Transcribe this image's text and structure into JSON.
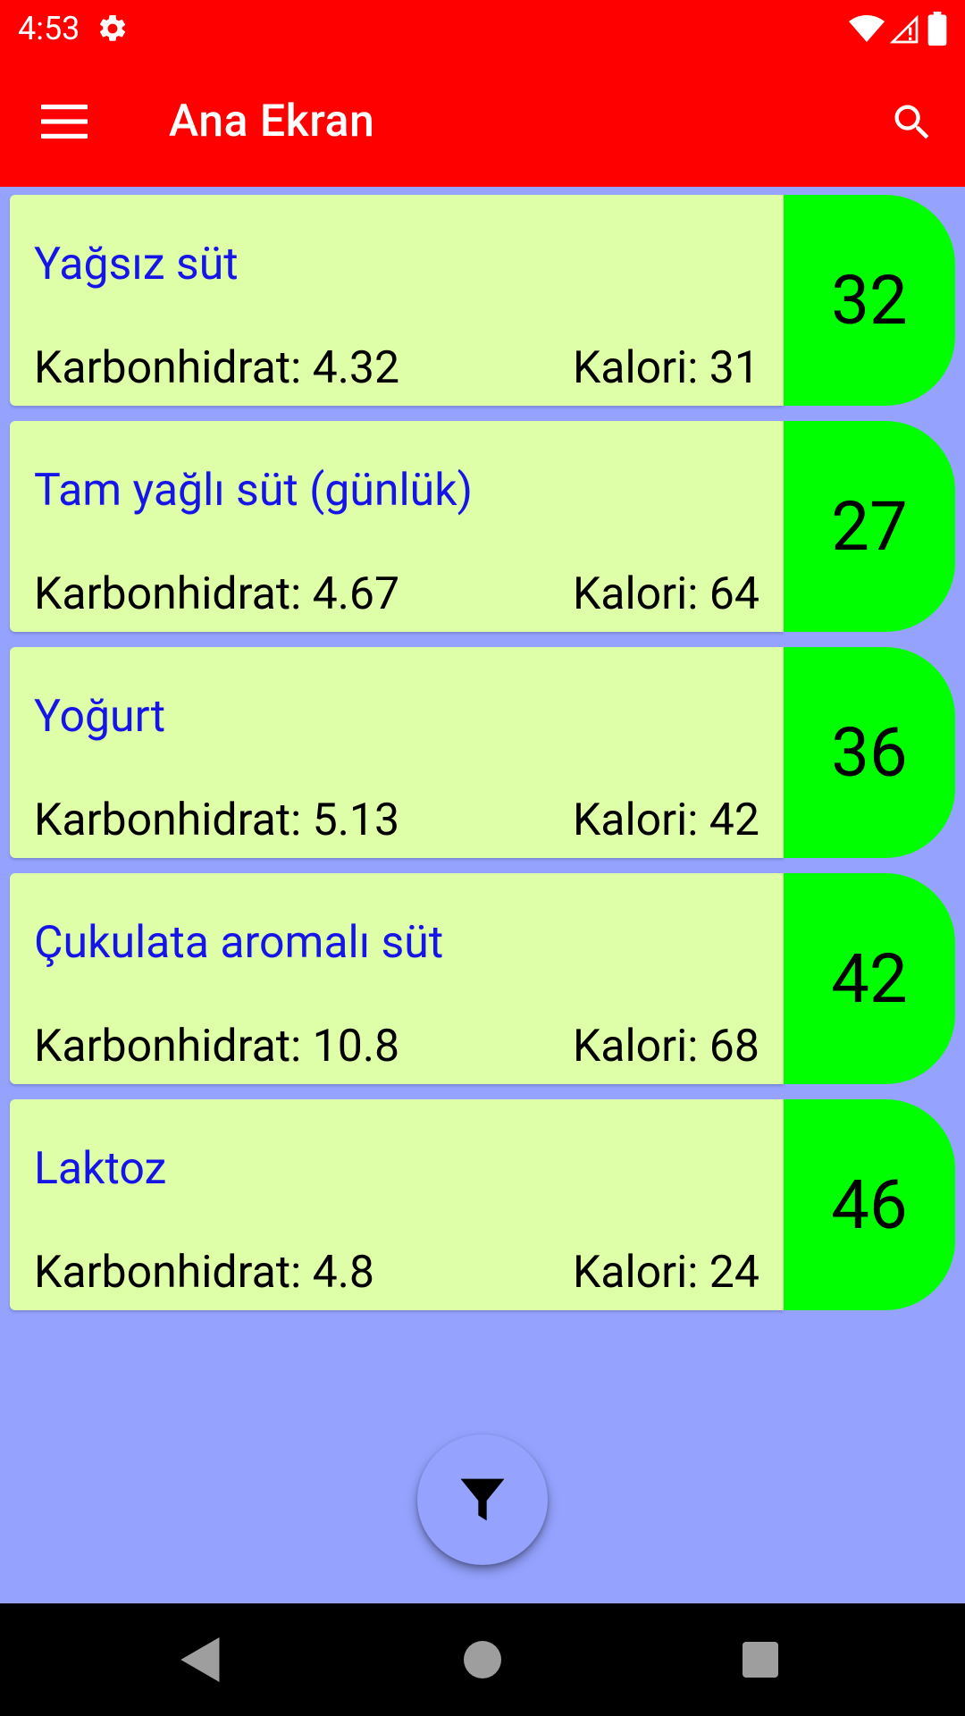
{
  "status_bar": {
    "time": "4:53"
  },
  "app_bar": {
    "title": "Ana Ekran"
  },
  "foods": [
    {
      "name": "Yağsız süt",
      "carb": "Karbonhidrat: 4.32",
      "calorie": "Kalori: 31",
      "gi": "32"
    },
    {
      "name": "Tam yağlı süt (günlük)",
      "carb": "Karbonhidrat: 4.67",
      "calorie": "Kalori: 64",
      "gi": "27"
    },
    {
      "name": "Yoğurt",
      "carb": "Karbonhidrat: 5.13",
      "calorie": "Kalori: 42",
      "gi": "36"
    },
    {
      "name": "Çukulata aromalı süt",
      "carb": "Karbonhidrat: 10.8",
      "calorie": "Kalori: 68",
      "gi": "42"
    },
    {
      "name": "Laktoz",
      "carb": "Karbonhidrat: 4.8",
      "calorie": "Kalori: 24",
      "gi": "46"
    }
  ],
  "icons": {
    "status": [
      "gear-icon",
      "wifi-icon",
      "signal-icon",
      "battery-icon"
    ],
    "app_bar": [
      "menu-icon",
      "search-icon"
    ],
    "fab": "filter-icon",
    "nav": [
      "back-icon",
      "home-icon",
      "recents-icon"
    ]
  },
  "colors": {
    "app_bar": "#ff0000",
    "background": "#95a3ff",
    "card": "#deffa8",
    "gi_badge": "#00ff00",
    "food_name": "#1515e8"
  }
}
